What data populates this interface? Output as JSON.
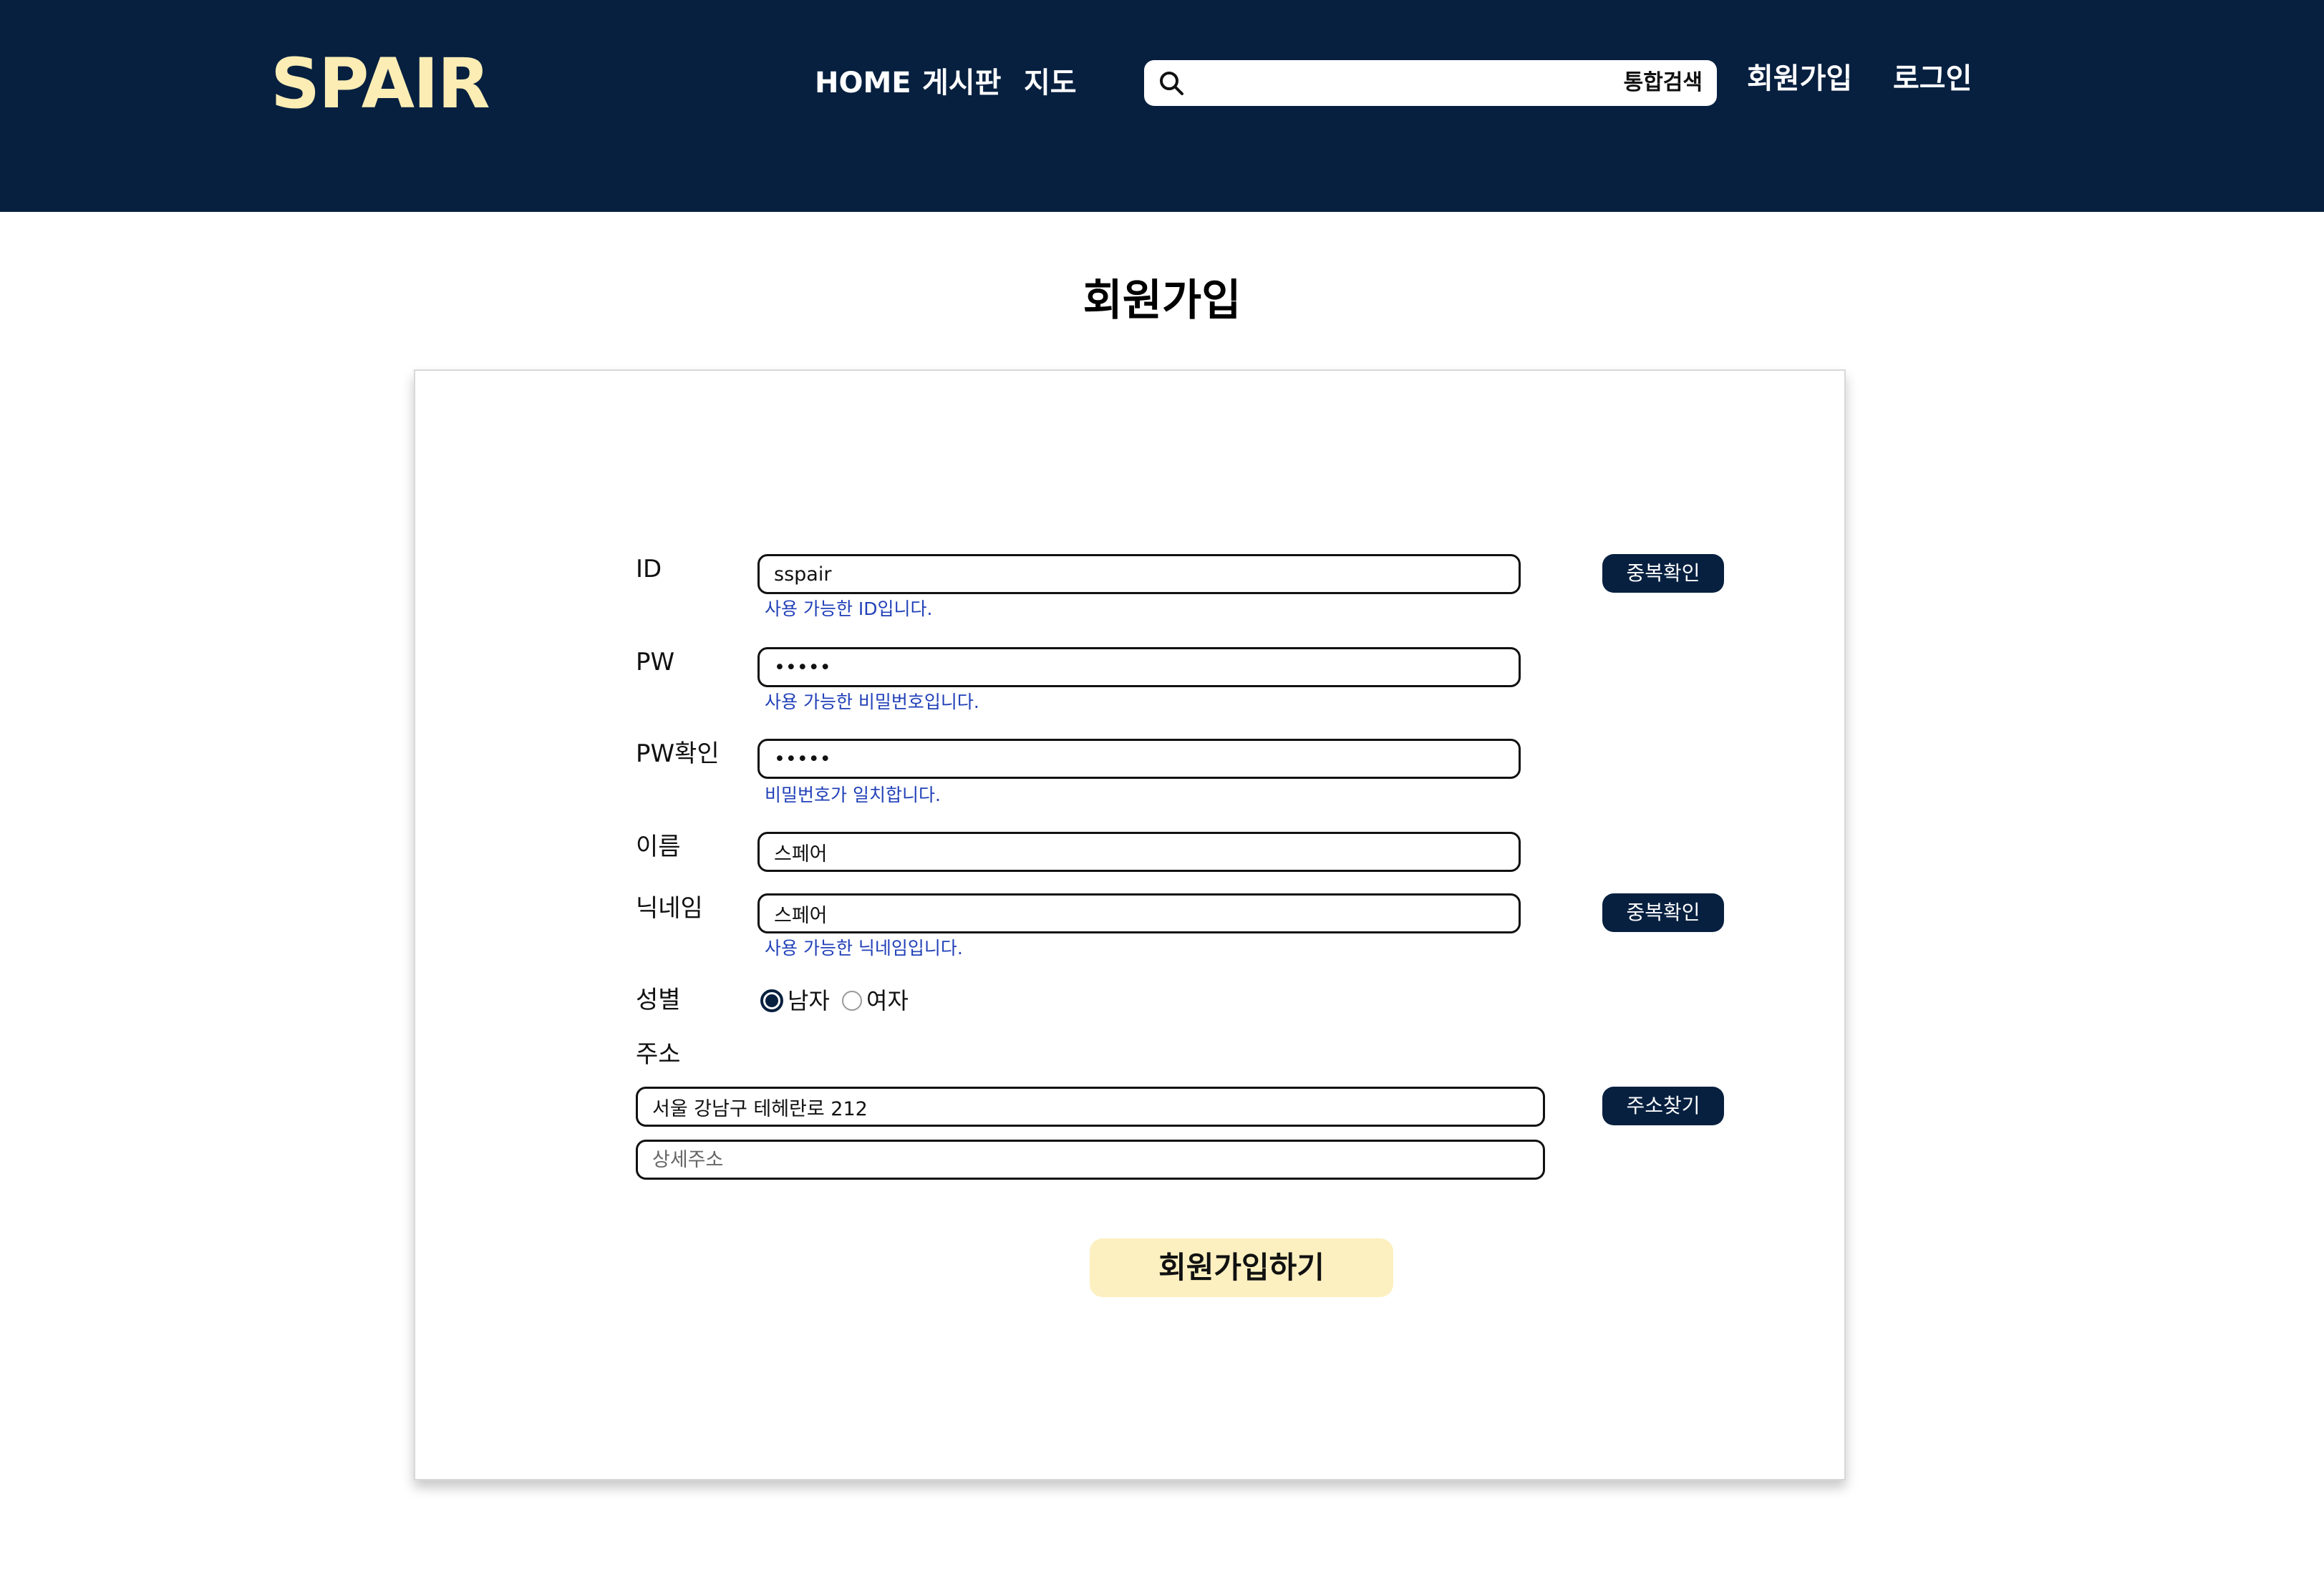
{
  "header": {
    "logo": "SPAIR",
    "nav": [
      "HOME",
      "게시판",
      "지도"
    ],
    "search": {
      "placeholder": "",
      "button_label": "통합검색"
    },
    "signup_link": "회원가입",
    "login_link": "로그인"
  },
  "page": {
    "title": "회원가입"
  },
  "form": {
    "id": {
      "label": "ID",
      "value": "sspair",
      "hint": "사용 가능한 ID입니다.",
      "check_button": "중복확인"
    },
    "pw": {
      "label": "PW",
      "value": "•••••",
      "hint": "사용 가능한 비밀번호입니다."
    },
    "pw_confirm": {
      "label": "PW확인",
      "value": "•••••",
      "hint": "비밀번호가 일치합니다."
    },
    "name": {
      "label": "이름",
      "value": "스페어"
    },
    "nickname": {
      "label": "닉네임",
      "value": "스페어",
      "hint": "사용 가능한 닉네임입니다.",
      "check_button": "중복확인"
    },
    "gender": {
      "label": "성별",
      "options": [
        "남자",
        "여자"
      ],
      "selected": "남자"
    },
    "address": {
      "label": "주소",
      "value": "서울 강남구 테헤란로 212",
      "find_button": "주소찾기",
      "detail_placeholder": "상세주소"
    },
    "submit_label": "회원가입하기"
  },
  "colors": {
    "header_bg": "#072040",
    "logo": "#fbedb4",
    "hint_text": "#2140b8",
    "submit_bg": "#fcf0c0"
  }
}
